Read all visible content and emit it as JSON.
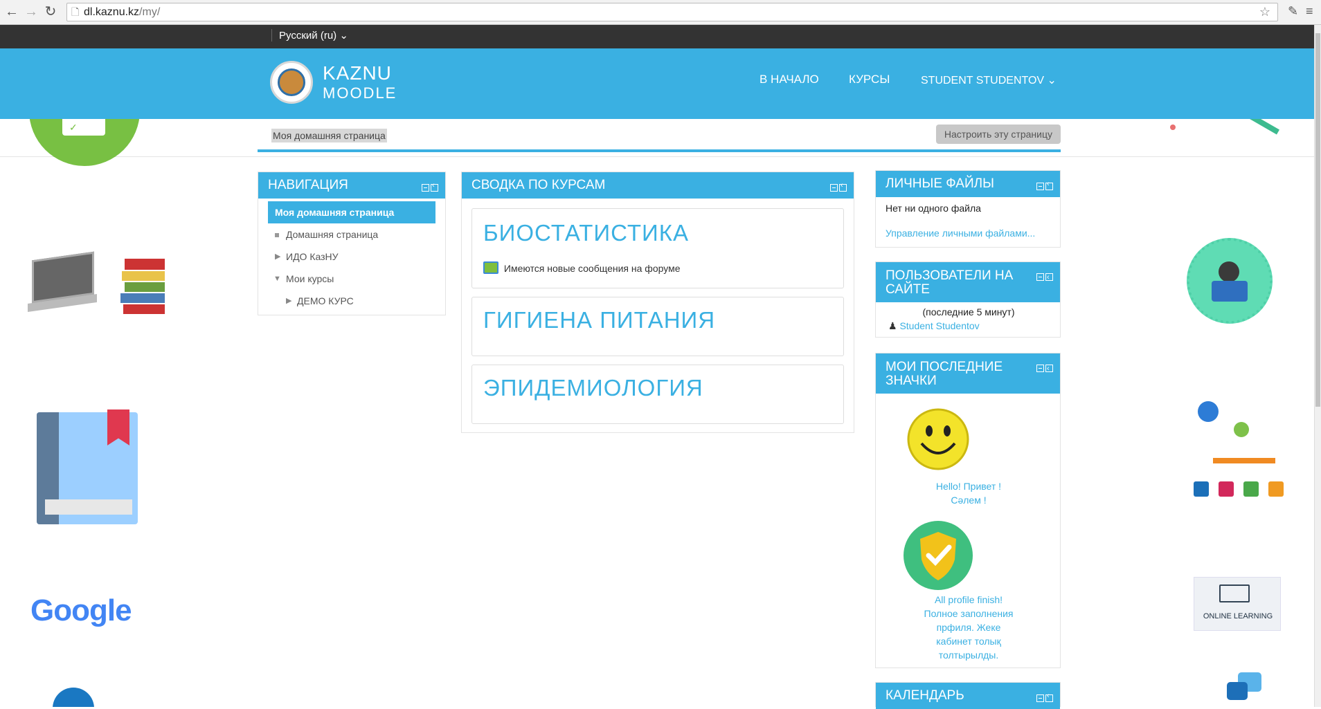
{
  "browser": {
    "url_host": "dl.kaznu.kz",
    "url_path": "/my/"
  },
  "lang": {
    "selected": "Русский (ru)"
  },
  "header": {
    "brand_line1": "KAZNU",
    "brand_line2": "MOODLE",
    "nav": [
      "В НАЧАЛО",
      "КУРСЫ",
      "STUDENT STUDENTOV"
    ]
  },
  "pagebar": {
    "breadcrumb": "Моя домашняя страница",
    "customize_label": "Настроить эту страницу"
  },
  "navigation": {
    "title": "НАВИГАЦИЯ",
    "active": "Моя домашняя страница",
    "items": [
      "Домашняя страница",
      "ИДО КазНУ",
      "Мои курсы",
      "ДЕМО КУРС"
    ]
  },
  "courses": {
    "title": "СВОДКА ПО КУРСАМ",
    "list": [
      {
        "name": "БИОСТАТИСТИКА",
        "note": "Имеются новые сообщения на форуме"
      },
      {
        "name": "ГИГИЕНА ПИТАНИЯ"
      },
      {
        "name": "ЭПИДЕМИОЛОГИЯ"
      }
    ]
  },
  "private_files": {
    "title": "ЛИЧНЫЕ ФАЙЛЫ",
    "empty": "Нет ни одного файла",
    "manage": "Управление личными файлами..."
  },
  "online_users": {
    "title_line1": "ПОЛЬЗОВАТЕЛИ НА",
    "title_line2": "САЙТЕ",
    "period": "(последние 5 минут)",
    "user": "Student Studentov"
  },
  "badges": {
    "title_line1": "МОИ ПОСЛЕДНИЕ",
    "title_line2": "ЗНАЧКИ",
    "items": [
      {
        "lines": [
          "Hello! Привет !",
          "Сәлем !"
        ]
      },
      {
        "lines": [
          "All profile finish!",
          "Полное заполнения",
          "прфиля. Жеке",
          "кабинет толық",
          "толтырылды."
        ]
      }
    ]
  },
  "calendar": {
    "title": "КАЛЕНДАРЬ"
  },
  "decorations": {
    "google_text": "Google",
    "online_learning_text": "ONLINE LEARNING"
  },
  "colors": {
    "accent": "#3ab0e2",
    "topbar": "#333333"
  }
}
